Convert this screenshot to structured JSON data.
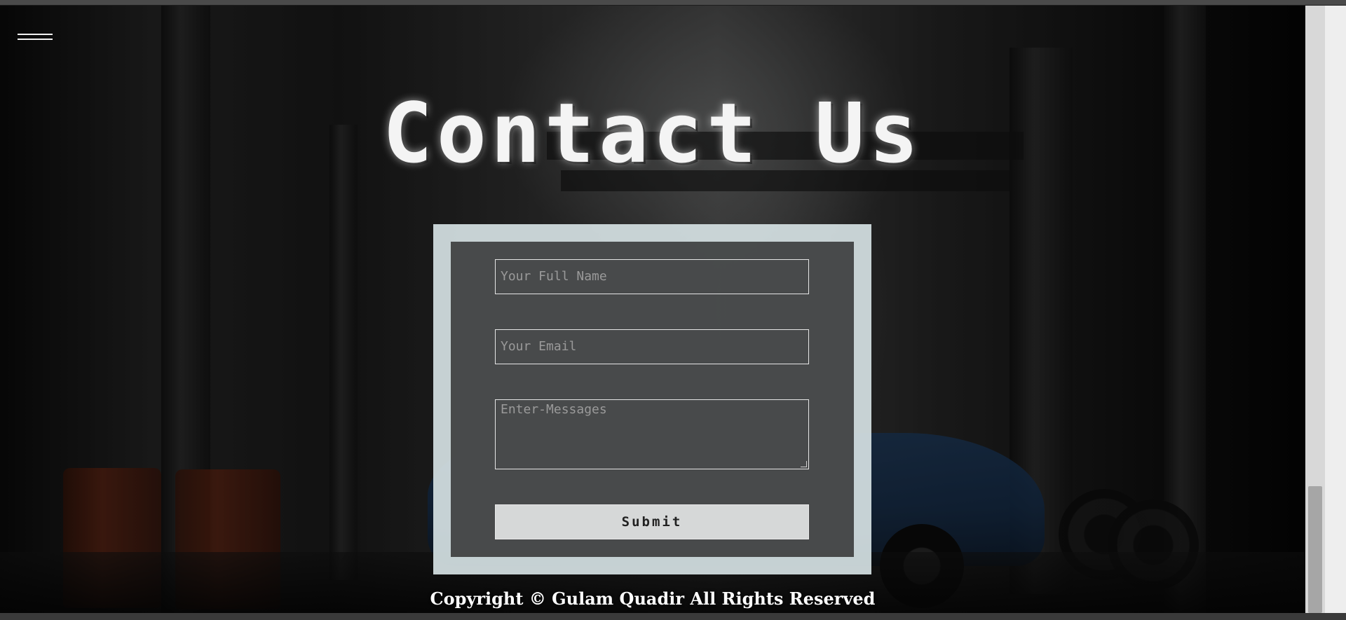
{
  "page": {
    "title": "Contact Us",
    "menu_icon": "hamburger-menu-icon"
  },
  "form": {
    "name_placeholder": "Your Full Name",
    "email_placeholder": "Your Email",
    "message_placeholder": "Enter-Messages",
    "submit_label": "Submit"
  },
  "footer": {
    "copyright": "Copyright © Gulam Quadir All Rights Reserved"
  },
  "colors": {
    "form_frame": "#d4e0e2",
    "form_panel": "#282828",
    "submit_bg": "#d6d8d8",
    "title_text": "#f4f4f4"
  }
}
